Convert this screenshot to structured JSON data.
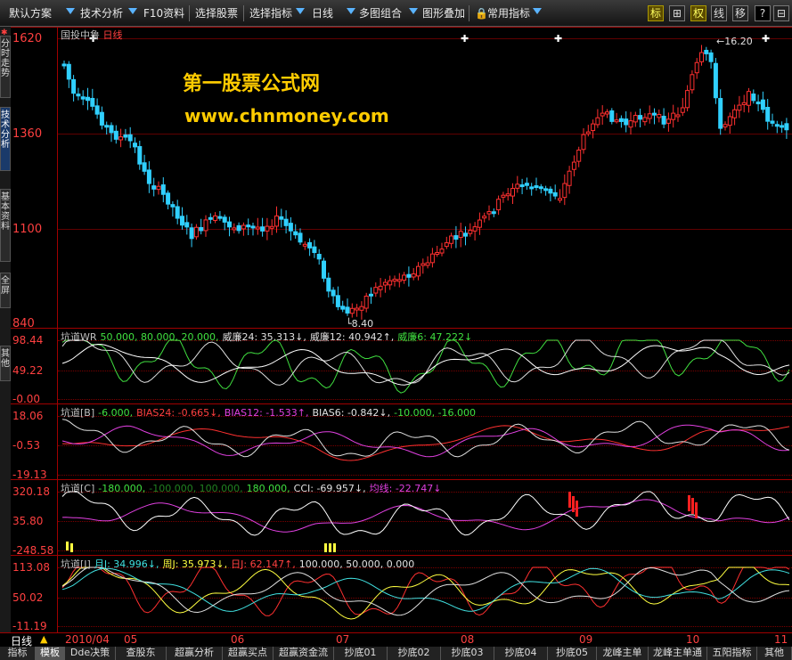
{
  "toolbar": {
    "items": [
      "默认方案",
      "技术分析",
      "F10资料",
      "选择股票",
      "选择指标",
      "日线",
      "多图组合",
      "图形叠加",
      "常用指标"
    ],
    "right_buttons": [
      "标",
      "⊞",
      "权",
      "线",
      "移",
      "?",
      "⊟"
    ]
  },
  "left_tabs": [
    "分时走势",
    "技术分析",
    "基本资料",
    "全屏",
    "其他"
  ],
  "stock": {
    "name": "国投中鲁",
    "period": "日线"
  },
  "watermark": {
    "line1": "第一股票公式网",
    "line2": "www.chnmoney.com"
  },
  "main_axis": {
    "labels": [
      "1620",
      "1360",
      "1100",
      "840"
    ]
  },
  "annotations": {
    "high": "16.20",
    "low": "8.40"
  },
  "panels": {
    "wr": {
      "axis": [
        "98.44",
        "49.22",
        "-0.00"
      ],
      "title": [
        {
          "text": "坑道WR",
          "color": "#c0c0c0"
        },
        {
          "text": "50.000, 80.000, 20.000,",
          "color": "#40e040"
        },
        {
          "text": "威廉24: 35.313↓,",
          "color": "#e0e0e0"
        },
        {
          "text": "威廉12: 40.942↑,",
          "color": "#e0e0e0"
        },
        {
          "text": "威廉6: 47.222↓",
          "color": "#40e040"
        }
      ]
    },
    "bias": {
      "axis": [
        "18.06",
        "-0.53",
        "-19.13"
      ],
      "title": [
        {
          "text": "坑道[B]",
          "color": "#c0c0c0"
        },
        {
          "text": "-6.000,",
          "color": "#40e040"
        },
        {
          "text": "BIAS24: -0.665↓,",
          "color": "#ff4040"
        },
        {
          "text": "BIAS12: -1.533↑,",
          "color": "#e040e0"
        },
        {
          "text": "BIAS6: -0.842↓,",
          "color": "#e0e0e0"
        },
        {
          "text": "-10.000, -16.000",
          "color": "#40e040"
        }
      ]
    },
    "cci": {
      "axis": [
        "320.18",
        "35.80",
        "-248.58"
      ],
      "title": [
        {
          "text": "坑道[C]",
          "color": "#c0c0c0"
        },
        {
          "text": "-180.000,",
          "color": "#40e040"
        },
        {
          "text": "-100.000, 100.000,",
          "color": "#208020"
        },
        {
          "text": "180.000,",
          "color": "#40e040"
        },
        {
          "text": "CCI: -69.957↓,",
          "color": "#e0e0e0"
        },
        {
          "text": "均线: -22.747↓",
          "color": "#e040e0"
        }
      ]
    },
    "j": {
      "axis": [
        "113.08",
        "50.02",
        "-11.19"
      ],
      "title": [
        {
          "text": "坑道[J]",
          "color": "#c0c0c0"
        },
        {
          "text": "月J: 34.996↓,",
          "color": "#40e0e0"
        },
        {
          "text": "周J: 35.973↓,",
          "color": "#ffff40"
        },
        {
          "text": "日J: 62.147↑,",
          "color": "#ff4040"
        },
        {
          "text": "100.000, 50.000, 0.000",
          "color": "#e0e0e0"
        }
      ]
    }
  },
  "x_axis": {
    "period_label": "日线",
    "labels": [
      "2010/04",
      "05",
      "06",
      "07",
      "08",
      "09",
      "10",
      "11"
    ]
  },
  "bottom_tabs": [
    "指标",
    "模板",
    "Dde决策",
    "查股东",
    "超赢分析",
    "超赢买点",
    "超赢资金流",
    "抄底01",
    "抄底02",
    "抄底03",
    "抄底04",
    "抄底05",
    "龙峰主单",
    "龙峰主单通",
    "五阳指标",
    "其他"
  ],
  "colors": {
    "up": "#ff3030",
    "down": "#30d0ff",
    "axis": "#a00000",
    "accent": "#ffcc00"
  }
}
